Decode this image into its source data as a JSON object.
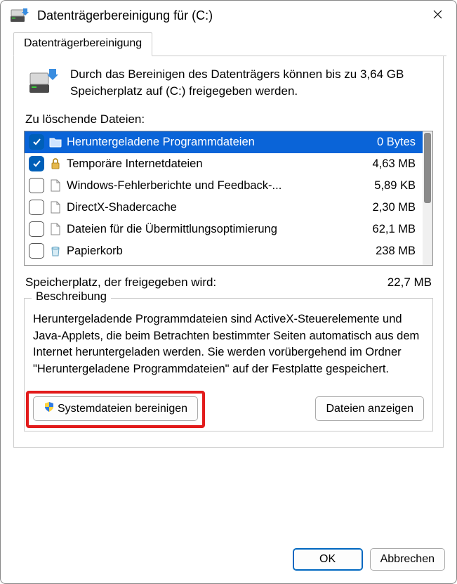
{
  "window": {
    "title": "Datenträgerbereinigung für  (C:)"
  },
  "tab": {
    "label": "Datenträgerbereinigung"
  },
  "intro": {
    "text": "Durch das Bereinigen des Datenträgers können bis zu 3,64 GB Speicherplatz auf  (C:) freigegeben werden."
  },
  "files": {
    "heading": "Zu löschende Dateien:",
    "items": [
      {
        "checked": true,
        "icon": "folder",
        "name": "Heruntergeladene Programmdateien",
        "size": "0 Bytes",
        "selected": true
      },
      {
        "checked": true,
        "icon": "lock",
        "name": "Temporäre Internetdateien",
        "size": "4,63 MB"
      },
      {
        "checked": false,
        "icon": "page",
        "name": "Windows-Fehlerberichte und Feedback-...",
        "size": "5,89 KB"
      },
      {
        "checked": false,
        "icon": "page",
        "name": "DirectX-Shadercache",
        "size": "2,30 MB"
      },
      {
        "checked": false,
        "icon": "page",
        "name": "Dateien für die Übermittlungsoptimierung",
        "size": "62,1 MB"
      },
      {
        "checked": false,
        "icon": "bin",
        "name": "Papierkorb",
        "size": "238 MB"
      }
    ]
  },
  "freed": {
    "label": "Speicherplatz, der freigegeben wird:",
    "value": "22,7 MB"
  },
  "description": {
    "heading": "Beschreibung",
    "text": "Heruntergeladende Programmdateien sind ActiveX-Steuerelemente und Java-Applets, die beim Betrachten bestimmter Seiten automatisch aus dem Internet heruntergeladen werden. Sie werden vorübergehend im Ordner \"Heruntergeladene Programmdateien\" auf der Festplatte gespeichert."
  },
  "buttons": {
    "cleanup_system": "Systemdateien bereinigen",
    "view_files": "Dateien anzeigen",
    "ok": "OK",
    "cancel": "Abbrechen"
  }
}
